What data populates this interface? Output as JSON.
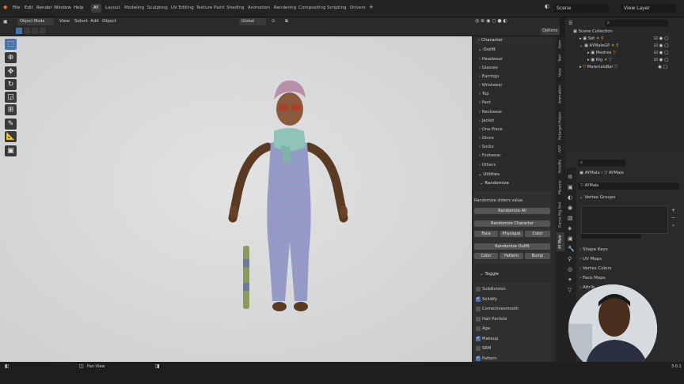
{
  "menu": {
    "items": [
      "File",
      "Edit",
      "Render",
      "Window",
      "Help"
    ]
  },
  "workspaces": [
    "AY",
    "Layout",
    "Modeling",
    "Sculpting",
    "UV Editing",
    "Texture Paint",
    "Shading",
    "Animation",
    "Rendering",
    "Compositing",
    "Scripting",
    "Drivers"
  ],
  "scene": {
    "name": "Scene",
    "view_layer": "View Layer"
  },
  "header": {
    "mode": "Object Mode",
    "view": "View",
    "select": "Select",
    "add": "Add",
    "object": "Object",
    "orientation": "Global",
    "options": "Options"
  },
  "npanel": {
    "character": "Character",
    "outfit": "Outfit",
    "outfit_items": [
      "Headwear",
      "Glasses",
      "Earrings",
      "Wristwear",
      "Top",
      "Pant",
      "Neckwear",
      "Jacket",
      "One-Piece",
      "Glove",
      "Socks",
      "Footwear",
      "Others"
    ],
    "utilities": "Utilities",
    "randomize": "Randomize",
    "randomize_note": "Randomize sliders value.",
    "randomize_all": "Randomize All",
    "randomize_character": "Randomize Character",
    "face": "Face",
    "physique": "Physique",
    "color1": "Color",
    "randomize_outfit": "Randomize Outfit",
    "color2": "Color",
    "pattern": "Pattern",
    "bump": "Bump",
    "toggle": "Toggle",
    "toggles": [
      {
        "label": "Subdivision",
        "on": false
      },
      {
        "label": "Solidify",
        "on": true
      },
      {
        "label": "Correctivesmooth",
        "on": false
      },
      {
        "label": "Hair Particle",
        "on": false
      },
      {
        "label": "Age",
        "on": false
      },
      {
        "label": "Makeup",
        "on": true
      },
      {
        "label": "SRM",
        "on": false
      },
      {
        "label": "Pattern",
        "on": true
      }
    ]
  },
  "vtabs": [
    "Item",
    "Tool",
    "View",
    "Animation",
    "Retarget Helper",
    "ARP",
    "RetoBlo",
    "Mixamo",
    "Game Rig Tool",
    "AY Male"
  ],
  "outliner": {
    "root": "Scene Collection",
    "rows": [
      "Set",
      "AYMaleGP",
      "Meshes",
      "Rig",
      "MaterialsBar"
    ]
  },
  "props": {
    "object": "AYMale",
    "object2": "AYMale",
    "mesh": "AYMale",
    "vertex_groups": "Vertex Groups",
    "shape_keys": "Shape Keys",
    "uv_maps": "UV Maps",
    "vertex_colors": "Vertex Colors",
    "face_maps": "Face Maps",
    "attributes": "Attrib"
  },
  "status": {
    "pan_view": "Pan View",
    "version": "3.0.1"
  }
}
